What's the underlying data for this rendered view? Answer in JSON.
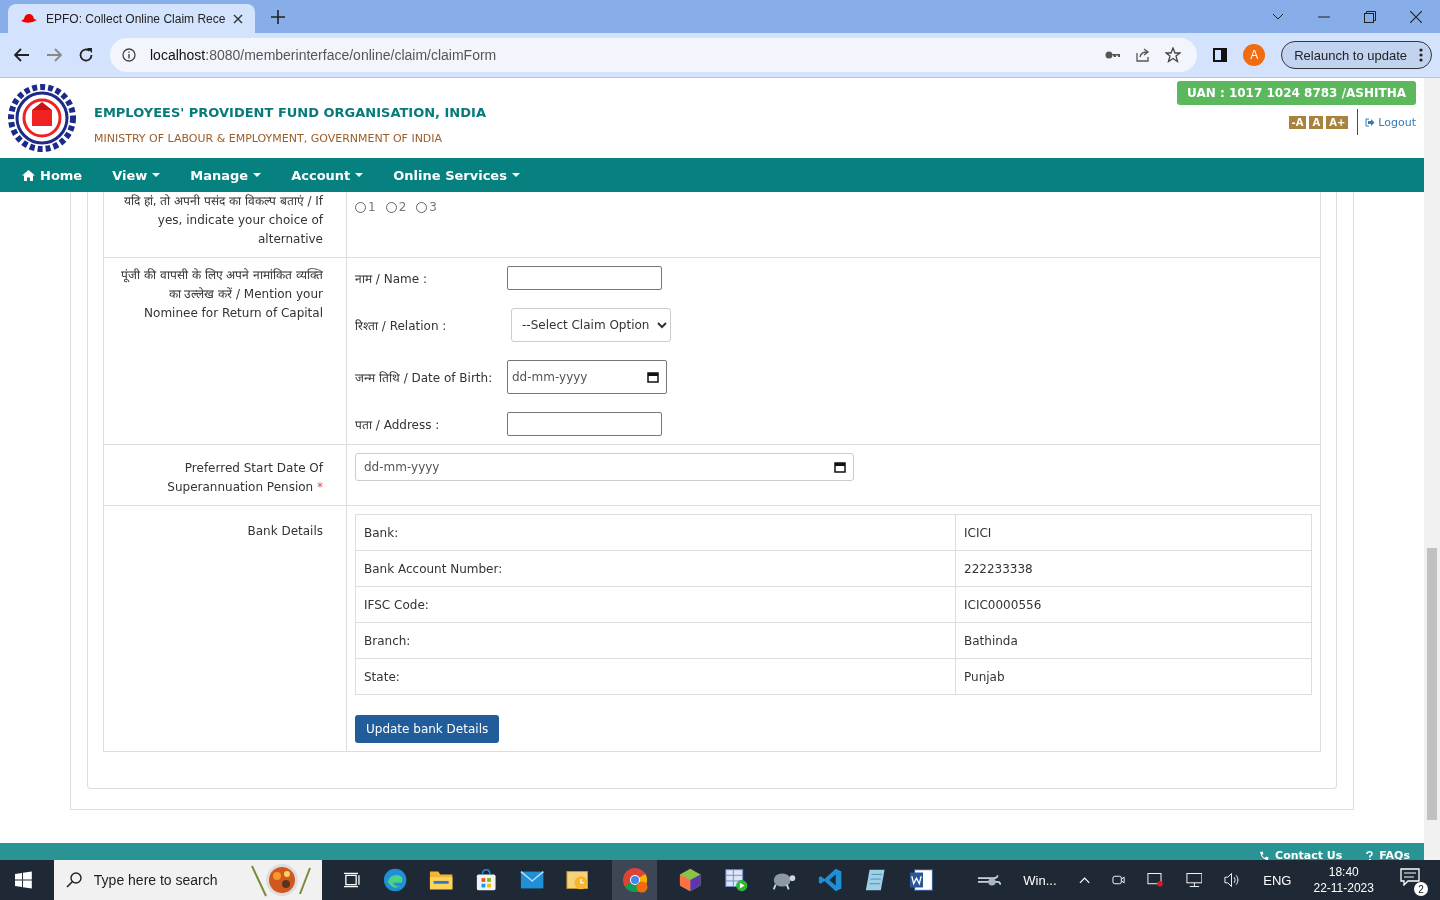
{
  "browser": {
    "tab_title": "EPFO: Collect Online Claim Rece",
    "url_host": "localhost",
    "url_rest": ":8080/memberinterface/online/claim/claimForm",
    "profile_initial": "A",
    "relaunch": "Relaunch to update"
  },
  "header": {
    "org_name": "EMPLOYEES' PROVIDENT FUND ORGANISATION, INDIA",
    "ministry": "MINISTRY OF LABOUR & EMPLOYMENT, GOVERNMENT OF INDIA",
    "uan": "UAN : 1017 1024 8783 /ASHITHA",
    "font_buttons": [
      "-A",
      "A",
      "A+"
    ],
    "logout": "Logout"
  },
  "nav": [
    {
      "label": "Home",
      "kind": "home"
    },
    {
      "label": "View",
      "kind": "dropdown"
    },
    {
      "label": "Manage",
      "kind": "dropdown"
    },
    {
      "label": "Account",
      "kind": "dropdown"
    },
    {
      "label": "Online Services",
      "kind": "dropdown"
    }
  ],
  "form": {
    "alternative": {
      "label": "यदि हां, तो अपनी पसंद का विकल्प बताएं / If yes, indicate your choice of alternative",
      "options": [
        {
          "label": "1",
          "selected": false
        },
        {
          "label": "2",
          "selected": false
        },
        {
          "label": "3",
          "selected": false
        }
      ]
    },
    "nominee": {
      "label": "पूंजी की वापसी के लिए अपने नामांकित व्यक्ति का उल्लेख करें / Mention your Nominee for Return of Capital",
      "fields": [
        {
          "kind": "text",
          "label": "नाम / Name :"
        },
        {
          "kind": "select",
          "label": "रिश्ता / Relation :",
          "value": "--Select Claim Option"
        },
        {
          "kind": "date",
          "label": "जन्म तिथि / Date of Birth:",
          "placeholder": "dd-mm-yyyy"
        },
        {
          "kind": "text",
          "label": "पता / Address :"
        }
      ]
    },
    "pension_start": {
      "label": "Preferred Start Date Of Superannuation Pension",
      "required_mark": "*",
      "placeholder": "dd-mm-yyyy"
    },
    "bank": {
      "label": "Bank Details",
      "rows": [
        {
          "key": "Bank:",
          "value": "ICICI"
        },
        {
          "key": "Bank Account Number:",
          "value": "222233338"
        },
        {
          "key": "IFSC Code:",
          "value": "ICIC0000556"
        },
        {
          "key": "Branch:",
          "value": "Bathinda"
        },
        {
          "key": "State:",
          "value": "Punjab"
        }
      ],
      "button": "Update bank Details"
    }
  },
  "footer": {
    "contact": "Contact Us",
    "faqs": "FAQs"
  },
  "taskbar": {
    "search_placeholder": "Type here to search",
    "weather": "Win...",
    "language": "ENG",
    "time": "18:40",
    "date": "22-11-2023",
    "notifications": "2"
  }
}
